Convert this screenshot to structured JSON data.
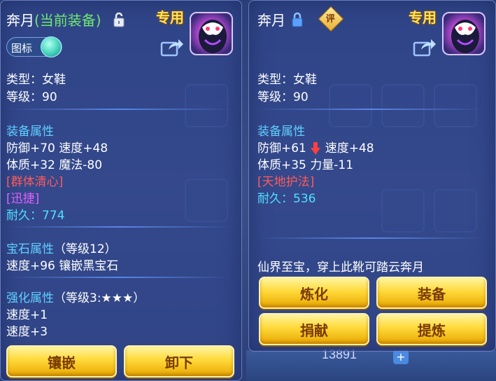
{
  "left": {
    "title_name": "奔月",
    "title_status": "(当前装备)",
    "special_label": "专用",
    "tag_toggle_label": "图标",
    "type_line": "类型：女鞋",
    "level_line": "等级：90",
    "equip_attr_head": "装备属性",
    "attr_line1": "防御+70 速度+48",
    "attr_line2": "体质+32 魔法-80",
    "skill1": "[群体清心]",
    "skill2": "[迅捷]",
    "durability_label": "耐久：",
    "durability_value": "774",
    "gem_head": "宝石属性",
    "gem_level": "（等级12）",
    "gem_line": "速度+96 镶嵌黑宝石",
    "enhance_head": "强化属性",
    "enhance_level": "（等级3:★★★）",
    "enhance_line1": "速度+1",
    "enhance_line2": "速度+3",
    "btn_inlay": "镶嵌",
    "btn_unequip": "卸下"
  },
  "right": {
    "title_name": "奔月",
    "review_badge": "评",
    "special_label": "专用",
    "type_line": "类型：女鞋",
    "level_line": "等级：90",
    "equip_attr_head": "装备属性",
    "attr_defense": "防御+61",
    "attr_speed": "速度+48",
    "attr_line2": "体质+35 力量-11",
    "skill1": "[天地护法]",
    "durability_label": "耐久：",
    "durability_value": "536",
    "description": "仙界至宝，穿上此靴可踏云奔月",
    "btn_refine": "炼化",
    "btn_equip": "装备",
    "btn_donate": "捐献",
    "btn_extract": "提炼"
  },
  "background": {
    "counter": "13891",
    "plus": "+"
  },
  "colors": {
    "panel": "#32468c",
    "title_green": "#6fe86f",
    "attr_head": "#5fd0ff",
    "skill_red": "#ff5a5a",
    "skill_purple": "#e060ff",
    "durability_cyan": "#4fe0ff",
    "special_gold": "#ffe25a",
    "button_gold": "#ffd93a"
  }
}
